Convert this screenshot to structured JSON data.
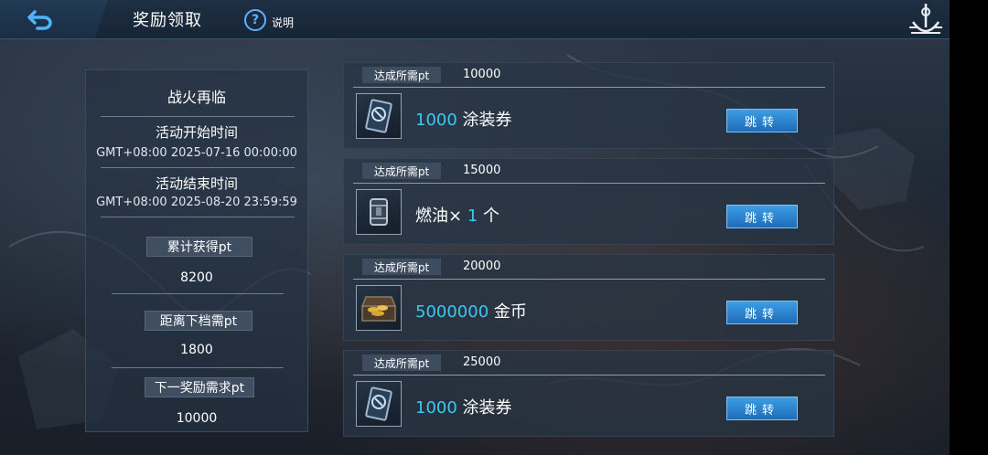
{
  "header": {
    "title": "奖励领取",
    "help_label": "说明"
  },
  "event": {
    "name": "战火再临",
    "start_label": "活动开始时间",
    "start_value": "GMT+08:00 2025-07-16 00:00:00",
    "end_label": "活动结束时间",
    "end_value": "GMT+08:00 2025-08-20 23:59:59"
  },
  "stats": {
    "total_label": "累计获得pt",
    "total_value": "8200",
    "next_tier_label": "距离下档需pt",
    "next_tier_value": "1800",
    "next_reward_label": "下一奖励需求pt",
    "next_reward_value": "10000"
  },
  "rewards": [
    {
      "req_label": "达成所需pt",
      "req_value": "10000",
      "amount": "1000",
      "item": " 涂装券",
      "icon": "paint-ticket-icon",
      "button": "跳转"
    },
    {
      "req_label": "达成所需pt",
      "req_value": "15000",
      "prefix": "燃油× ",
      "amount": "1",
      "item": " 个",
      "icon": "fuel-barrel-icon",
      "button": "跳转"
    },
    {
      "req_label": "达成所需pt",
      "req_value": "20000",
      "amount": "5000000",
      "item": " 金币",
      "icon": "gold-chest-icon",
      "button": "跳转"
    },
    {
      "req_label": "达成所需pt",
      "req_value": "25000",
      "amount": "1000",
      "item": " 涂装券",
      "icon": "paint-ticket-icon",
      "button": "跳转"
    }
  ],
  "colors": {
    "highlight": "#3cc8f2",
    "button": "#2b86d0",
    "accent": "#5fb0ff"
  }
}
